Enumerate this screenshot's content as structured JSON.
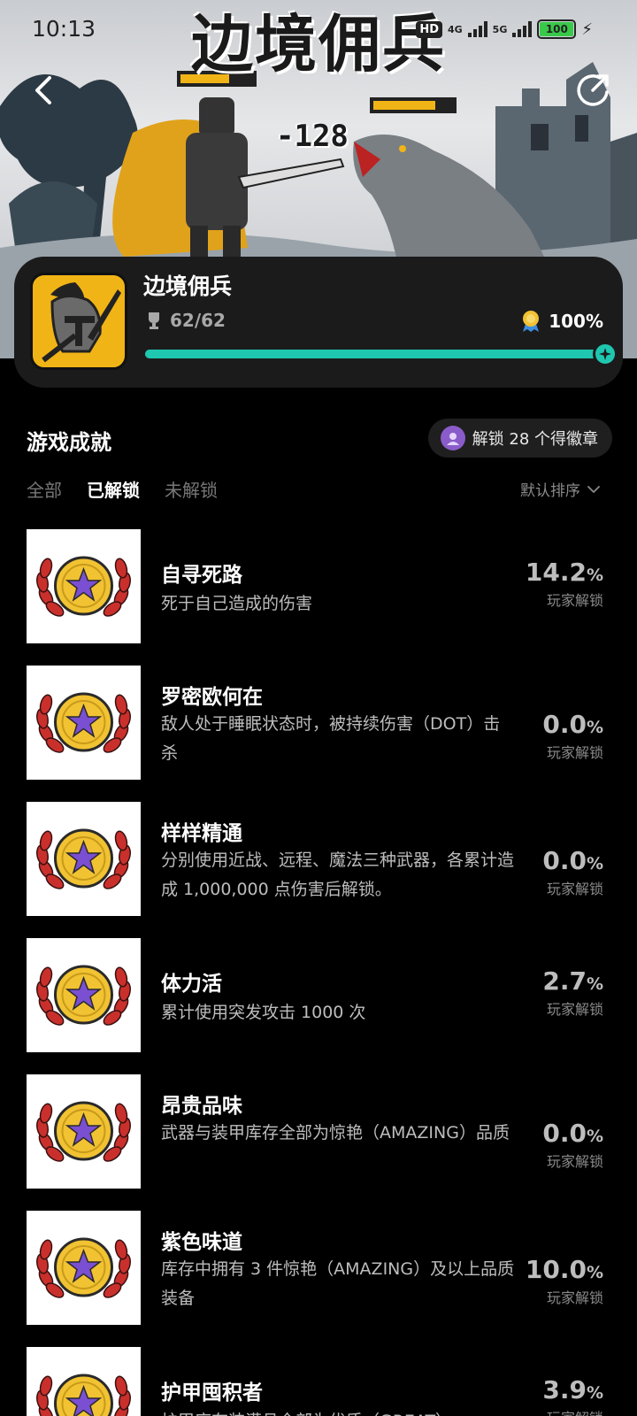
{
  "status_bar": {
    "time": "10:13",
    "hd": "HD",
    "net_4g": "4G",
    "net_5g": "5G",
    "battery": "100"
  },
  "hero": {
    "title": "边境佣兵",
    "damage": "-128"
  },
  "game": {
    "name": "边境佣兵",
    "trophies": "62/62",
    "completion": "100%",
    "progress": 1.0
  },
  "achievements": {
    "section_title": "游戏成就",
    "badge_pill": "解锁 28 个得徽章",
    "tabs": [
      "全部",
      "已解锁",
      "未解锁"
    ],
    "active_tab": "已解锁",
    "sort_label": "默认排序",
    "rate_label": "玩家解锁",
    "items": [
      {
        "title": "自寻死路",
        "desc": "死于自己造成的伤害",
        "rate": "14.2",
        "pct": "%"
      },
      {
        "title": "罗密欧何在",
        "desc": "敌人处于睡眠状态时，被持续伤害（DOT）击杀",
        "rate": "0.0",
        "pct": "%"
      },
      {
        "title": "样样精通",
        "desc": "分别使用近战、远程、魔法三种武器，各累计造成 1,000,000 点伤害后解锁。",
        "rate": "0.0",
        "pct": "%"
      },
      {
        "title": "体力活",
        "desc": "累计使用突发攻击 1000 次",
        "rate": "2.7",
        "pct": "%"
      },
      {
        "title": "昂贵品味",
        "desc": "武器与装甲库存全部为惊艳（AMAZING）品质",
        "rate": "0.0",
        "pct": "%"
      },
      {
        "title": "紫色味道",
        "desc": "库存中拥有 3 件惊艳（AMAZING）及以上品质装备",
        "rate": "10.0",
        "pct": "%"
      },
      {
        "title": "护甲囤积者",
        "desc": "护甲库存装满且全部为优质（GREAT）",
        "rate": "3.9",
        "pct": "%"
      }
    ]
  },
  "colors": {
    "accent": "#1fc7b0",
    "card_bg": "#1b1b1b",
    "badge_gold": "#f1c232",
    "badge_star": "#7b4fd1",
    "laurel": "#c9302c"
  }
}
